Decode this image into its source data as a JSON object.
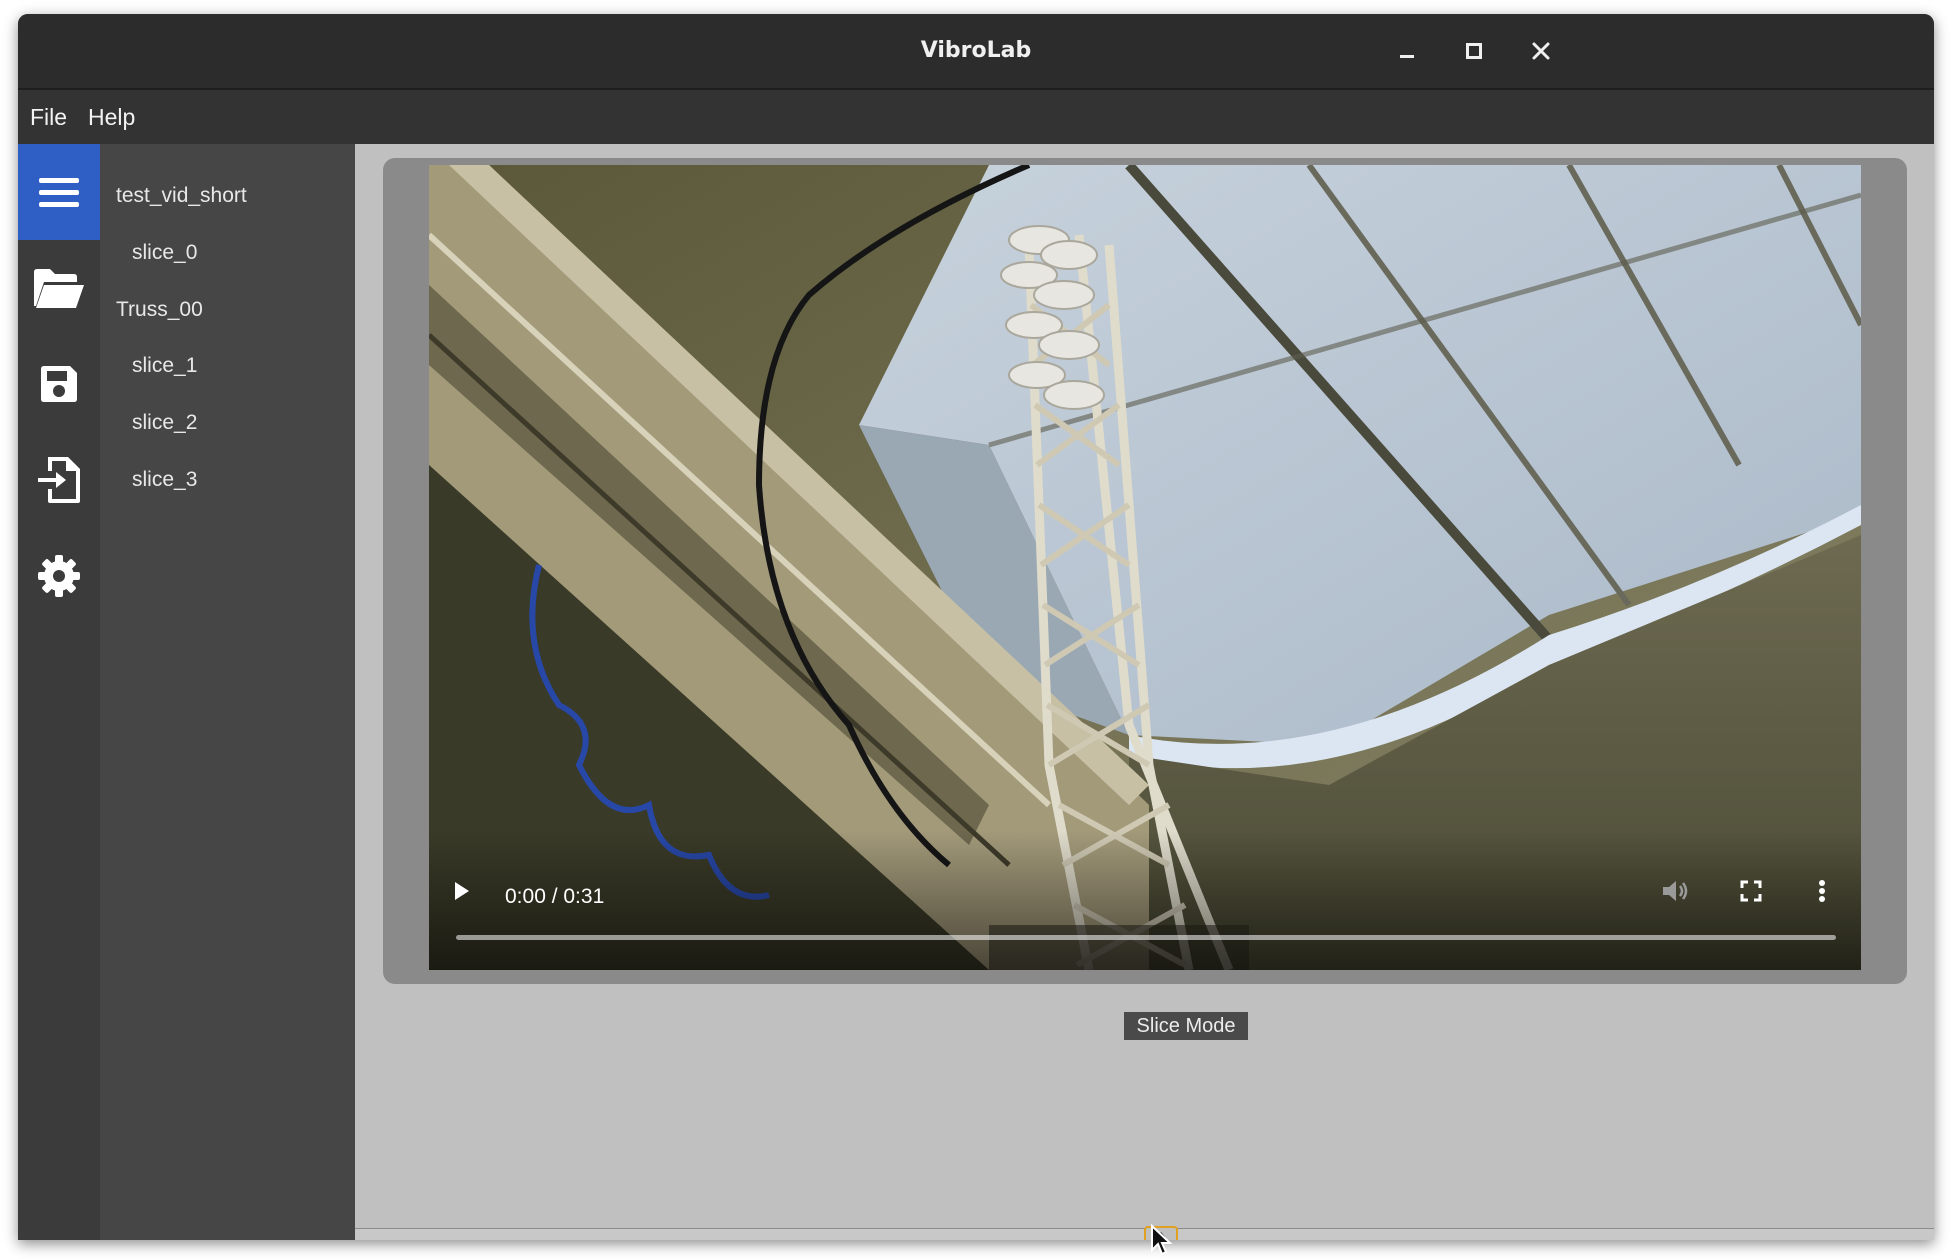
{
  "window": {
    "title": "VibroLab",
    "controls": [
      "minimize-icon",
      "maximize-icon",
      "close-icon"
    ]
  },
  "menubar": {
    "items": [
      {
        "label": "File"
      },
      {
        "label": "Help"
      }
    ]
  },
  "iconbar": {
    "items": [
      {
        "icon": "hamburger-menu-icon",
        "active": true
      },
      {
        "icon": "folder-open-icon",
        "active": false
      },
      {
        "icon": "save-icon",
        "active": false
      },
      {
        "icon": "import-icon",
        "active": false
      },
      {
        "icon": "gear-icon",
        "active": false
      }
    ],
    "active_color": "#2f5fc4"
  },
  "tree": {
    "items": [
      {
        "label": "test_vid_short",
        "level": 0
      },
      {
        "label": "slice_0",
        "level": 1
      },
      {
        "label": "Truss_00",
        "level": 0
      },
      {
        "label": "slice_1",
        "level": 1
      },
      {
        "label": "slice_2",
        "level": 1
      },
      {
        "label": "slice_3",
        "level": 1
      }
    ]
  },
  "player": {
    "time": "0:00 / 0:31",
    "progress": 0.0,
    "controls": [
      "play-icon",
      "volume-icon",
      "fullscreen-icon",
      "more-options-icon"
    ]
  },
  "main": {
    "mode_button": "Slice Mode"
  }
}
